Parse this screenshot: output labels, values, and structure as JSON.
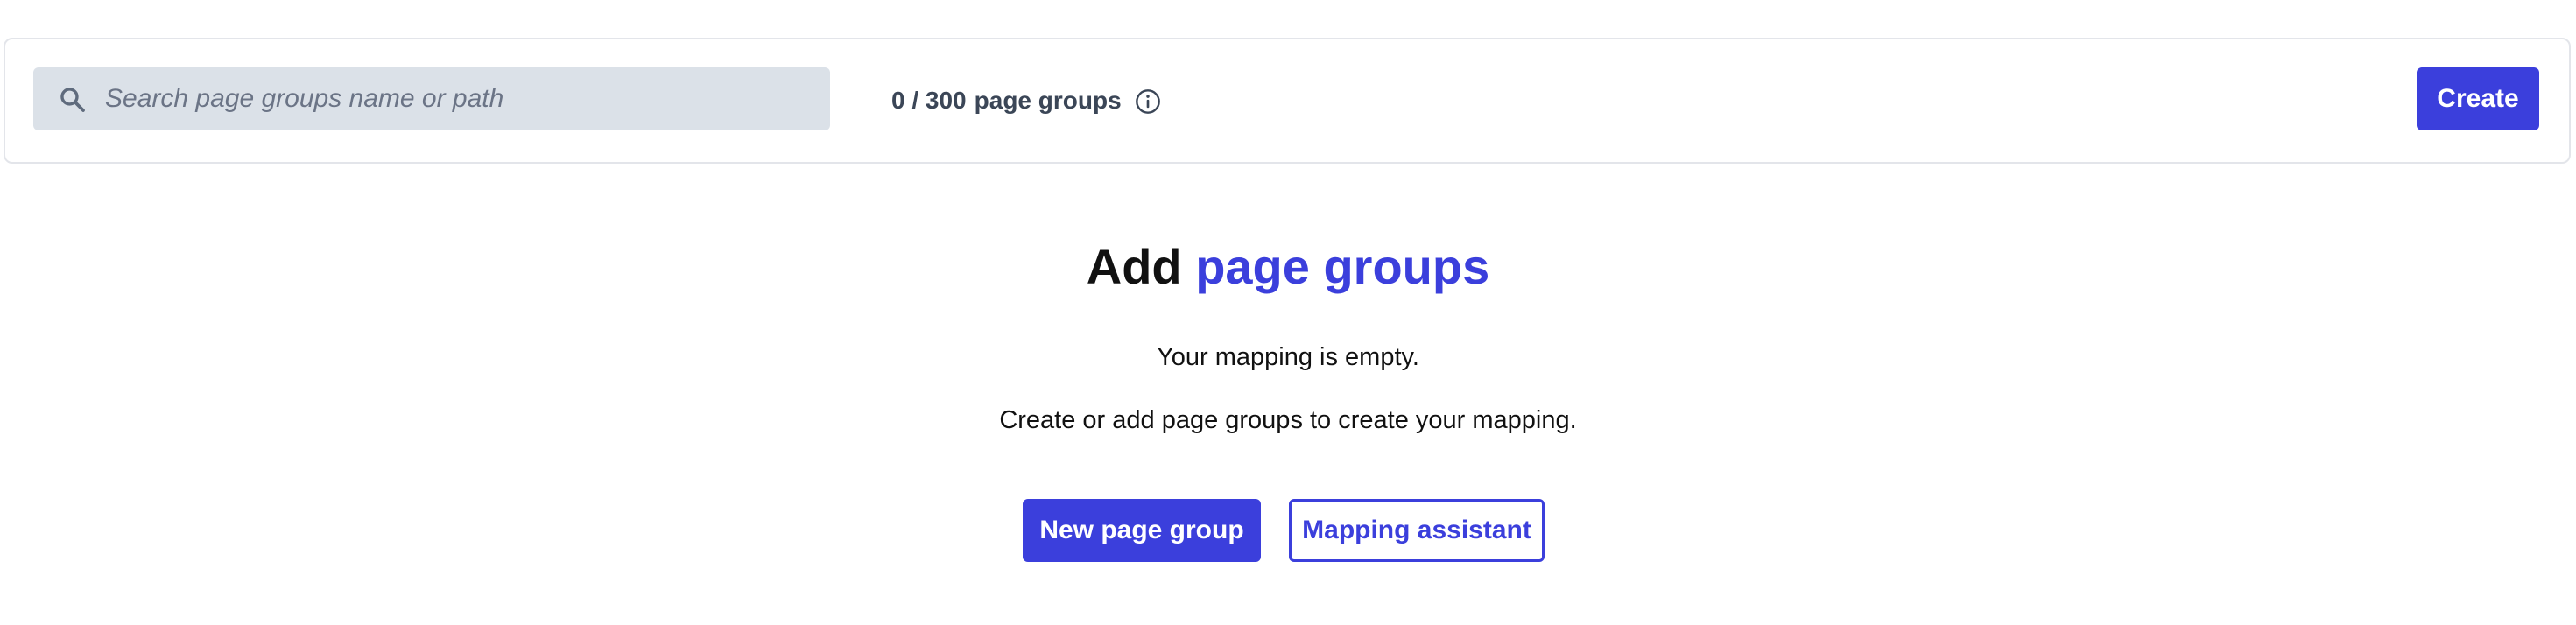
{
  "toolbar": {
    "search": {
      "placeholder": "Search page groups name or path",
      "value": ""
    },
    "count": {
      "current": "0 / 300",
      "label": "page groups"
    },
    "create_label": "Create"
  },
  "empty_state": {
    "title_prefix": "Add",
    "title_accent": "page groups",
    "line1": "Your mapping is empty.",
    "line2": "Create or add page groups to create your mapping.",
    "primary_label": "New page group",
    "secondary_label": "Mapping assistant"
  },
  "icons": {
    "search": "search-icon",
    "info": "info-icon"
  },
  "colors": {
    "accent": "#3b3fdc",
    "search_bg": "#dbe1e8",
    "muted_text": "#3b4657",
    "border": "#e3e5ea"
  }
}
